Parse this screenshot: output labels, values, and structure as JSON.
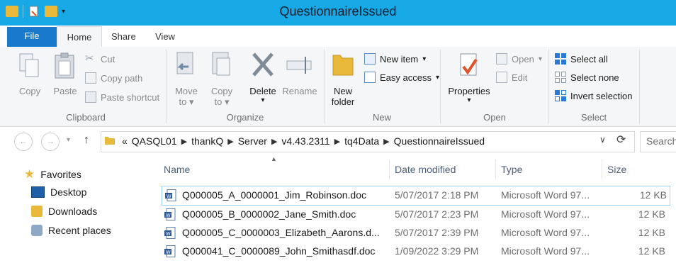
{
  "window": {
    "title": "QuestionnaireIssued"
  },
  "tabs": {
    "file": "File",
    "home": "Home",
    "share": "Share",
    "view": "View"
  },
  "ribbon": {
    "clipboard": {
      "label": "Clipboard",
      "copy": "Copy",
      "paste": "Paste",
      "cut": "Cut",
      "copy_path": "Copy path",
      "paste_shortcut": "Paste shortcut"
    },
    "organize": {
      "label": "Organize",
      "move_to": [
        "Move",
        "to"
      ],
      "copy_to": [
        "Copy",
        "to"
      ],
      "delete": "Delete",
      "rename": "Rename"
    },
    "new": {
      "label": "New",
      "new_folder": [
        "New",
        "folder"
      ],
      "new_item": "New item",
      "easy_access": "Easy access"
    },
    "open": {
      "label": "Open",
      "properties": "Properties",
      "open": "Open",
      "edit": "Edit"
    },
    "select": {
      "label": "Select",
      "select_all": "Select all",
      "select_none": "Select none",
      "invert": "Invert selection"
    }
  },
  "address": {
    "prefix": "«",
    "crumbs": [
      "QASQL01",
      "thankQ",
      "Server",
      "v4.43.2311",
      "tq4Data",
      "QuestionnaireIssued"
    ],
    "search_placeholder": "Search"
  },
  "nav": {
    "favorites": "Favorites",
    "items": [
      "Desktop",
      "Downloads",
      "Recent places"
    ]
  },
  "columns": {
    "name": "Name",
    "date": "Date modified",
    "type": "Type",
    "size": "Size"
  },
  "files": [
    {
      "name": "Q000005_A_0000001_Jim_Robinson.doc",
      "date": "5/07/2017 2:18 PM",
      "type": "Microsoft Word 97...",
      "size": "12 KB"
    },
    {
      "name": "Q000005_B_0000002_Jane_Smith.doc",
      "date": "5/07/2017 2:23 PM",
      "type": "Microsoft Word 97...",
      "size": "12 KB"
    },
    {
      "name": "Q000005_C_0000003_Elizabeth_Aarons.d...",
      "date": "5/07/2017 2:39 PM",
      "type": "Microsoft Word 97...",
      "size": "12 KB"
    },
    {
      "name": "Q000041_C_0000089_John_Smithasdf.doc",
      "date": "1/09/2022 3:29 PM",
      "type": "Microsoft Word 97...",
      "size": "12 KB"
    }
  ],
  "colors": {
    "titlebar": "#17a9e6",
    "file_tab": "#1979ca",
    "folder": "#e8b93a",
    "select_blue": "#2b79d6"
  }
}
